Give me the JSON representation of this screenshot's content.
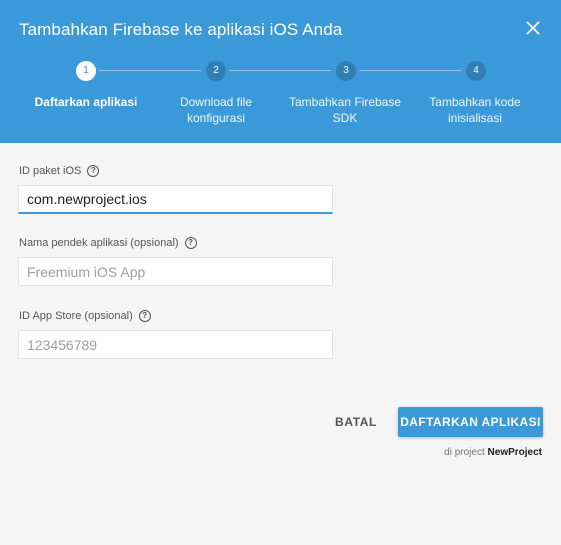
{
  "dialog": {
    "title": "Tambahkan Firebase ke aplikasi iOS Anda",
    "close_icon": "close-icon"
  },
  "steps": [
    {
      "number": "1",
      "label": "Daftarkan aplikasi",
      "active": true
    },
    {
      "number": "2",
      "label": "Download file konfigurasi",
      "active": false
    },
    {
      "number": "3",
      "label": "Tambahkan Firebase SDK",
      "active": false
    },
    {
      "number": "4",
      "label": "Tambahkan kode inisialisasi",
      "active": false
    }
  ],
  "form": {
    "bundle_id": {
      "label": "ID paket iOS",
      "value": "com.newproject.ios",
      "placeholder": ""
    },
    "nickname": {
      "label": "Nama pendek aplikasi (opsional)",
      "value": "",
      "placeholder": "Freemium iOS App"
    },
    "app_store_id": {
      "label": "ID App Store (opsional)",
      "value": "",
      "placeholder": "123456789"
    }
  },
  "actions": {
    "cancel_label": "BATAL",
    "register_label": "DAFTARKAN APLIKASI"
  },
  "footer": {
    "prefix": "di project",
    "project_name": "NewProject"
  },
  "colors": {
    "header": "#3a99d8",
    "primary_button": "#3a99d8",
    "background": "#f5f5f5"
  }
}
